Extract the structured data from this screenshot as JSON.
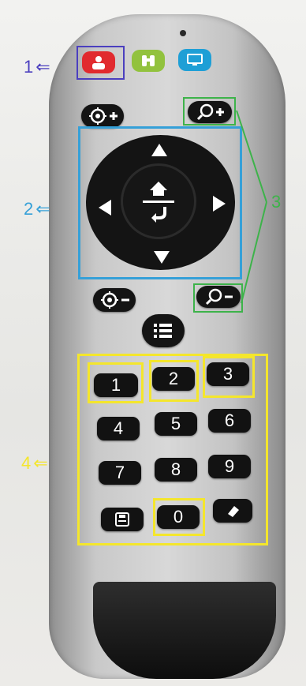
{
  "annotations": {
    "label_1": "1",
    "label_2": "2",
    "label_3": "3",
    "label_4": "4",
    "arrow_glyph": "⇐",
    "colors": {
      "one": "#4b3fbf",
      "two": "#35a0d8",
      "three": "#3db34a",
      "four": "#f4e62c"
    }
  },
  "keypad": {
    "k1": "1",
    "k2": "2",
    "k3": "3",
    "k4": "4",
    "k5": "5",
    "k6": "6",
    "k7": "7",
    "k8": "8",
    "k9": "9",
    "k0": "0"
  },
  "icons": {
    "top_buttons": [
      "profile-icon",
      "binoculars-icon",
      "monitor-icon"
    ],
    "side_buttons": [
      "target-plus-icon",
      "target-minus-icon",
      "zoom-in-icon",
      "zoom-out-icon",
      "menu-icon"
    ],
    "dpad": [
      "up-arrow-icon",
      "down-arrow-icon",
      "left-arrow-icon",
      "right-arrow-icon",
      "home-center-icon"
    ],
    "keypad_extra": [
      "save-icon",
      "eraser-icon"
    ]
  }
}
